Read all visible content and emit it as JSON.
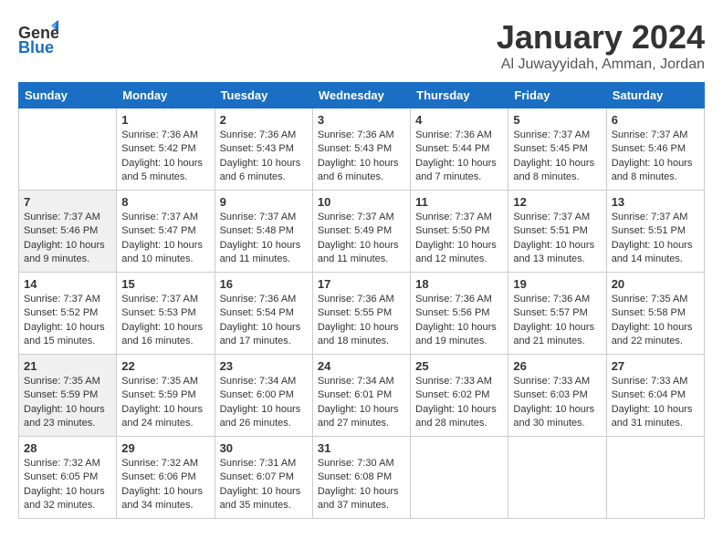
{
  "header": {
    "logo_general": "General",
    "logo_blue": "Blue",
    "month_title": "January 2024",
    "location": "Al Juwayyidah, Amman, Jordan"
  },
  "days_of_week": [
    "Sunday",
    "Monday",
    "Tuesday",
    "Wednesday",
    "Thursday",
    "Friday",
    "Saturday"
  ],
  "weeks": [
    [
      {
        "day": "",
        "info": ""
      },
      {
        "day": "1",
        "info": "Sunrise: 7:36 AM\nSunset: 5:42 PM\nDaylight: 10 hours\nand 5 minutes."
      },
      {
        "day": "2",
        "info": "Sunrise: 7:36 AM\nSunset: 5:43 PM\nDaylight: 10 hours\nand 6 minutes."
      },
      {
        "day": "3",
        "info": "Sunrise: 7:36 AM\nSunset: 5:43 PM\nDaylight: 10 hours\nand 6 minutes."
      },
      {
        "day": "4",
        "info": "Sunrise: 7:36 AM\nSunset: 5:44 PM\nDaylight: 10 hours\nand 7 minutes."
      },
      {
        "day": "5",
        "info": "Sunrise: 7:37 AM\nSunset: 5:45 PM\nDaylight: 10 hours\nand 8 minutes."
      },
      {
        "day": "6",
        "info": "Sunrise: 7:37 AM\nSunset: 5:46 PM\nDaylight: 10 hours\nand 8 minutes."
      }
    ],
    [
      {
        "day": "7",
        "info": "Sunrise: 7:37 AM\nSunset: 5:46 PM\nDaylight: 10 hours\nand 9 minutes."
      },
      {
        "day": "8",
        "info": "Sunrise: 7:37 AM\nSunset: 5:47 PM\nDaylight: 10 hours\nand 10 minutes."
      },
      {
        "day": "9",
        "info": "Sunrise: 7:37 AM\nSunset: 5:48 PM\nDaylight: 10 hours\nand 11 minutes."
      },
      {
        "day": "10",
        "info": "Sunrise: 7:37 AM\nSunset: 5:49 PM\nDaylight: 10 hours\nand 11 minutes."
      },
      {
        "day": "11",
        "info": "Sunrise: 7:37 AM\nSunset: 5:50 PM\nDaylight: 10 hours\nand 12 minutes."
      },
      {
        "day": "12",
        "info": "Sunrise: 7:37 AM\nSunset: 5:51 PM\nDaylight: 10 hours\nand 13 minutes."
      },
      {
        "day": "13",
        "info": "Sunrise: 7:37 AM\nSunset: 5:51 PM\nDaylight: 10 hours\nand 14 minutes."
      }
    ],
    [
      {
        "day": "14",
        "info": "Sunrise: 7:37 AM\nSunset: 5:52 PM\nDaylight: 10 hours\nand 15 minutes."
      },
      {
        "day": "15",
        "info": "Sunrise: 7:37 AM\nSunset: 5:53 PM\nDaylight: 10 hours\nand 16 minutes."
      },
      {
        "day": "16",
        "info": "Sunrise: 7:36 AM\nSunset: 5:54 PM\nDaylight: 10 hours\nand 17 minutes."
      },
      {
        "day": "17",
        "info": "Sunrise: 7:36 AM\nSunset: 5:55 PM\nDaylight: 10 hours\nand 18 minutes."
      },
      {
        "day": "18",
        "info": "Sunrise: 7:36 AM\nSunset: 5:56 PM\nDaylight: 10 hours\nand 19 minutes."
      },
      {
        "day": "19",
        "info": "Sunrise: 7:36 AM\nSunset: 5:57 PM\nDaylight: 10 hours\nand 21 minutes."
      },
      {
        "day": "20",
        "info": "Sunrise: 7:35 AM\nSunset: 5:58 PM\nDaylight: 10 hours\nand 22 minutes."
      }
    ],
    [
      {
        "day": "21",
        "info": "Sunrise: 7:35 AM\nSunset: 5:59 PM\nDaylight: 10 hours\nand 23 minutes."
      },
      {
        "day": "22",
        "info": "Sunrise: 7:35 AM\nSunset: 5:59 PM\nDaylight: 10 hours\nand 24 minutes."
      },
      {
        "day": "23",
        "info": "Sunrise: 7:34 AM\nSunset: 6:00 PM\nDaylight: 10 hours\nand 26 minutes."
      },
      {
        "day": "24",
        "info": "Sunrise: 7:34 AM\nSunset: 6:01 PM\nDaylight: 10 hours\nand 27 minutes."
      },
      {
        "day": "25",
        "info": "Sunrise: 7:33 AM\nSunset: 6:02 PM\nDaylight: 10 hours\nand 28 minutes."
      },
      {
        "day": "26",
        "info": "Sunrise: 7:33 AM\nSunset: 6:03 PM\nDaylight: 10 hours\nand 30 minutes."
      },
      {
        "day": "27",
        "info": "Sunrise: 7:33 AM\nSunset: 6:04 PM\nDaylight: 10 hours\nand 31 minutes."
      }
    ],
    [
      {
        "day": "28",
        "info": "Sunrise: 7:32 AM\nSunset: 6:05 PM\nDaylight: 10 hours\nand 32 minutes."
      },
      {
        "day": "29",
        "info": "Sunrise: 7:32 AM\nSunset: 6:06 PM\nDaylight: 10 hours\nand 34 minutes."
      },
      {
        "day": "30",
        "info": "Sunrise: 7:31 AM\nSunset: 6:07 PM\nDaylight: 10 hours\nand 35 minutes."
      },
      {
        "day": "31",
        "info": "Sunrise: 7:30 AM\nSunset: 6:08 PM\nDaylight: 10 hours\nand 37 minutes."
      },
      {
        "day": "",
        "info": ""
      },
      {
        "day": "",
        "info": ""
      },
      {
        "day": "",
        "info": ""
      }
    ]
  ]
}
